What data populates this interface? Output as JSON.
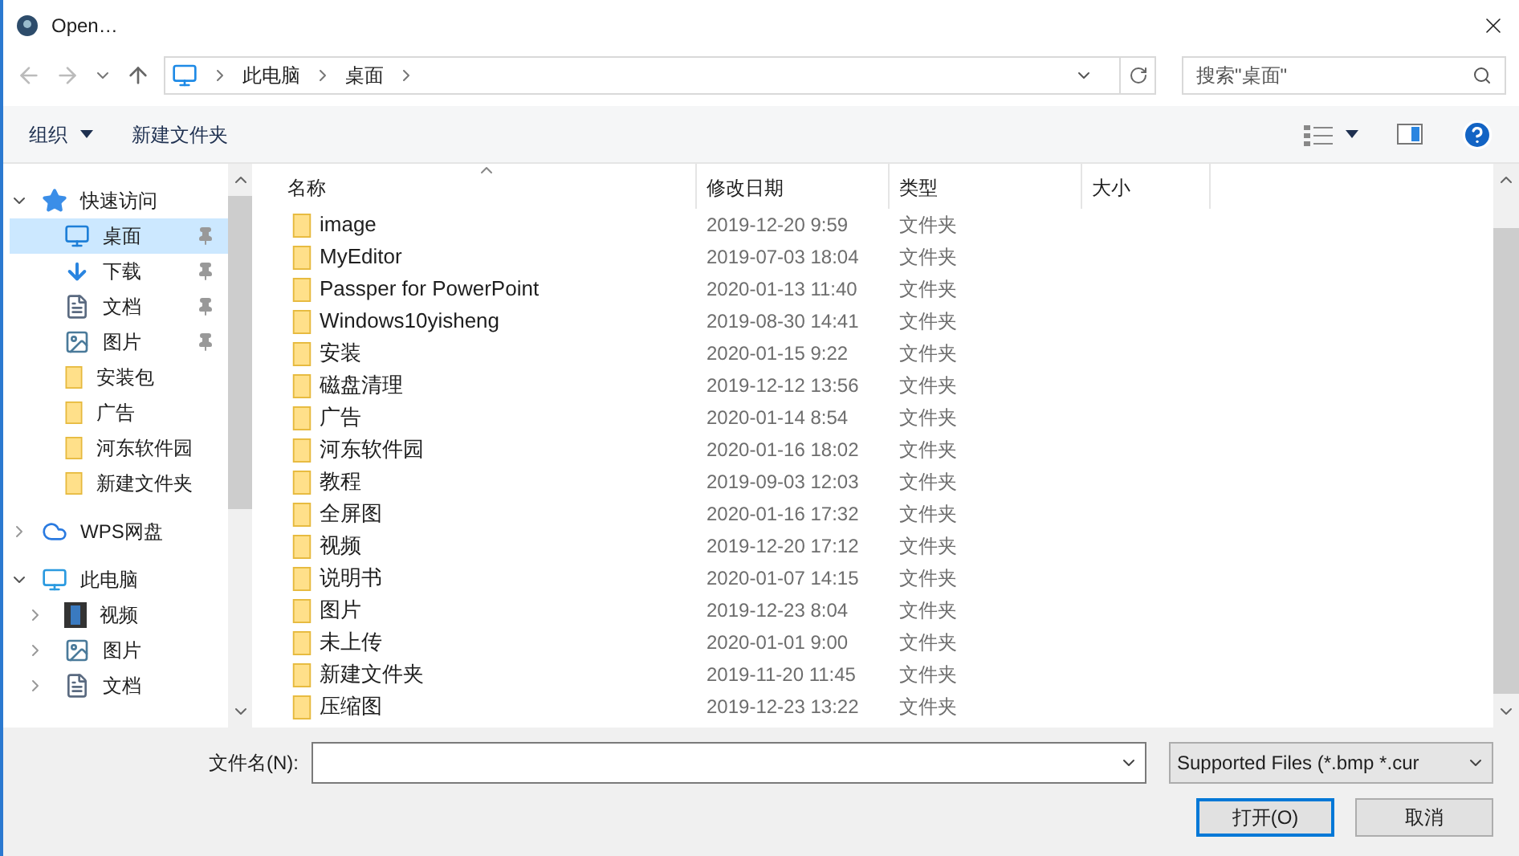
{
  "window": {
    "title": "Open…"
  },
  "address": {
    "path": [
      "此电脑",
      "桌面"
    ],
    "search_placeholder": "搜索\"桌面\""
  },
  "toolbar": {
    "organize": "组织",
    "new_folder": "新建文件夹"
  },
  "nav": [
    {
      "label": "快速访问",
      "kind": "star",
      "expanded": true,
      "children": [
        {
          "label": "桌面",
          "kind": "desktop",
          "pinned": true,
          "selected": true
        },
        {
          "label": "下载",
          "kind": "download",
          "pinned": true,
          "selected": false
        },
        {
          "label": "文档",
          "kind": "document",
          "pinned": true,
          "selected": false
        },
        {
          "label": "图片",
          "kind": "pictures",
          "pinned": true,
          "selected": false
        },
        {
          "label": "安装包",
          "kind": "folder",
          "pinned": false,
          "selected": false
        },
        {
          "label": "广告",
          "kind": "folder",
          "pinned": false,
          "selected": false
        },
        {
          "label": "河东软件园",
          "kind": "folder",
          "pinned": false,
          "selected": false
        },
        {
          "label": "新建文件夹",
          "kind": "folder",
          "pinned": false,
          "selected": false
        }
      ]
    },
    {
      "label": "WPS网盘",
      "kind": "cloud",
      "expanded": false
    },
    {
      "label": "此电脑",
      "kind": "pc",
      "expanded": true,
      "children": [
        {
          "label": "视频",
          "kind": "video",
          "expandable": true,
          "selected": false
        },
        {
          "label": "图片",
          "kind": "pictures",
          "expandable": true,
          "selected": false
        },
        {
          "label": "文档",
          "kind": "document",
          "expandable": true,
          "selected": false
        }
      ]
    }
  ],
  "table": {
    "columns": [
      "名称",
      "修改日期",
      "类型",
      "大小"
    ],
    "rows": [
      [
        "image",
        "2019-12-20 9:59",
        "文件夹"
      ],
      [
        "MyEditor",
        "2019-07-03 18:04",
        "文件夹"
      ],
      [
        "Passper for PowerPoint",
        "2020-01-13 11:40",
        "文件夹"
      ],
      [
        "Windows10yisheng",
        "2019-08-30 14:41",
        "文件夹"
      ],
      [
        "安装",
        "2020-01-15 9:22",
        "文件夹"
      ],
      [
        "磁盘清理",
        "2019-12-12 13:56",
        "文件夹"
      ],
      [
        "广告",
        "2020-01-14 8:54",
        "文件夹"
      ],
      [
        "河东软件园",
        "2020-01-16 18:02",
        "文件夹"
      ],
      [
        "教程",
        "2019-09-03 12:03",
        "文件夹"
      ],
      [
        "全屏图",
        "2020-01-16 17:32",
        "文件夹"
      ],
      [
        "视频",
        "2019-12-20 17:12",
        "文件夹"
      ],
      [
        "说明书",
        "2020-01-07 14:15",
        "文件夹"
      ],
      [
        "图片",
        "2019-12-23 8:04",
        "文件夹"
      ],
      [
        "未上传",
        "2020-01-01 9:00",
        "文件夹"
      ],
      [
        "新建文件夹",
        "2019-11-20 11:45",
        "文件夹"
      ],
      [
        "压缩图",
        "2019-12-23 13:22",
        "文件夹"
      ]
    ]
  },
  "footer": {
    "filename_label": "文件名(N):",
    "filter": "Supported Files (*.bmp *.cur",
    "open": "打开(O)",
    "cancel": "取消"
  }
}
